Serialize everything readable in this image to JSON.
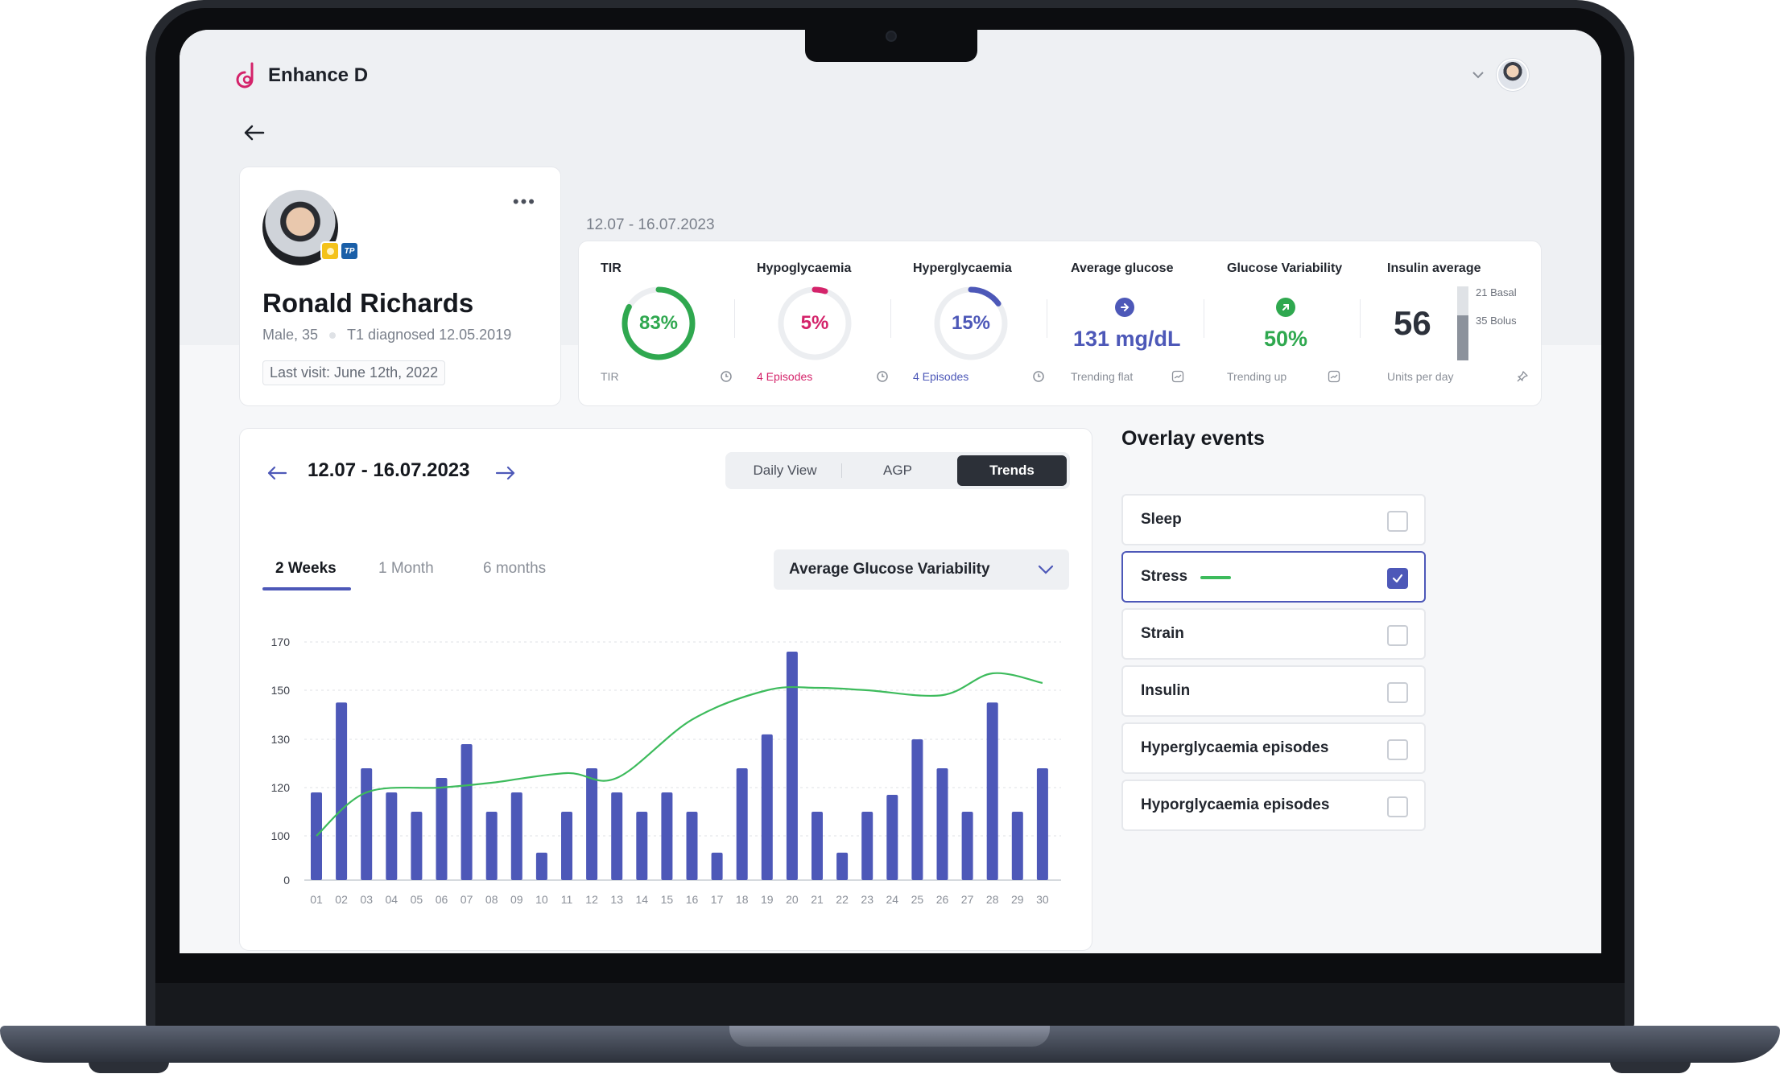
{
  "app": {
    "name": "Enhance D"
  },
  "patient": {
    "name": "Ronald Richards",
    "sex_age": "Male, 35",
    "diagnosis": "T1 diagnosed 12.05.2019",
    "last_visit": "Last visit: June 12th, 2022",
    "badge_tp": "TP"
  },
  "summary": {
    "range": "12.07 - 16.07.2023",
    "tir": {
      "title": "TIR",
      "value": "83%",
      "fraction": 0.83,
      "sub": "TIR",
      "color": "#2fa84f"
    },
    "hypo": {
      "title": "Hypoglycaemia",
      "value": "5%",
      "fraction": 0.05,
      "sub": "4 Episodes",
      "color": "#d4236a"
    },
    "hyper": {
      "title": "Hyperglycaemia",
      "value": "15%",
      "fraction": 0.15,
      "sub": "4 Episodes",
      "color": "#4d58b8"
    },
    "avg": {
      "title": "Average glucose",
      "value": "131 mg/dL",
      "sub": "Trending flat",
      "color": "#4d58b8"
    },
    "variability": {
      "title": "Glucose Variability",
      "value": "50%",
      "sub": "Trending up",
      "color": "#2fa84f"
    },
    "insulin": {
      "title": "Insulin average",
      "value": "56",
      "basal": "21 Basal",
      "bolus": "35 Bolus",
      "sub": "Units per day"
    }
  },
  "chart_panel": {
    "range": "12.07 - 16.07.2023",
    "views": [
      "Daily View",
      "AGP",
      "Trends"
    ],
    "active_view": "Trends",
    "periods": [
      "2 Weeks",
      "1 Month",
      "6 months"
    ],
    "active_period": "2 Weeks",
    "metric": "Average Glucose Variability"
  },
  "chart_data": {
    "type": "bar",
    "categories": [
      "01",
      "02",
      "03",
      "04",
      "05",
      "06",
      "07",
      "08",
      "09",
      "10",
      "11",
      "12",
      "13",
      "14",
      "15",
      "16",
      "17",
      "18",
      "19",
      "20",
      "21",
      "22",
      "23",
      "24",
      "25",
      "26",
      "27",
      "28",
      "29",
      "30"
    ],
    "values": [
      118,
      145,
      124,
      118,
      110,
      122,
      129,
      110,
      118,
      62,
      110,
      124,
      118,
      110,
      118,
      110,
      62,
      124,
      132,
      166,
      110,
      62,
      110,
      117,
      130,
      124,
      110,
      145,
      110,
      124
    ],
    "series_line": [
      {
        "x": "01",
        "y": 100
      },
      {
        "x": "03",
        "y": 118
      },
      {
        "x": "06",
        "y": 120
      },
      {
        "x": "08",
        "y": 121
      },
      {
        "x": "11",
        "y": 123
      },
      {
        "x": "13",
        "y": 122
      },
      {
        "x": "16",
        "y": 138
      },
      {
        "x": "19",
        "y": 150
      },
      {
        "x": "21",
        "y": 151
      },
      {
        "x": "23",
        "y": 150
      },
      {
        "x": "26",
        "y": 148
      },
      {
        "x": "28",
        "y": 157
      },
      {
        "x": "30",
        "y": 153
      }
    ],
    "yticks": [
      "170",
      "150",
      "130",
      "120",
      "100",
      "0"
    ],
    "bar_color": "#4d58b8",
    "line_color": "#3dbb5c",
    "grid": true
  },
  "overlay": {
    "title": "Overlay events",
    "items": [
      {
        "label": "Sleep",
        "checked": false
      },
      {
        "label": "Stress",
        "checked": true
      },
      {
        "label": "Strain",
        "checked": false
      },
      {
        "label": "Insulin",
        "checked": false
      },
      {
        "label": "Hyperglycaemia episodes",
        "checked": false
      },
      {
        "label": "Hyporglycaemia episodes",
        "checked": false
      }
    ]
  }
}
